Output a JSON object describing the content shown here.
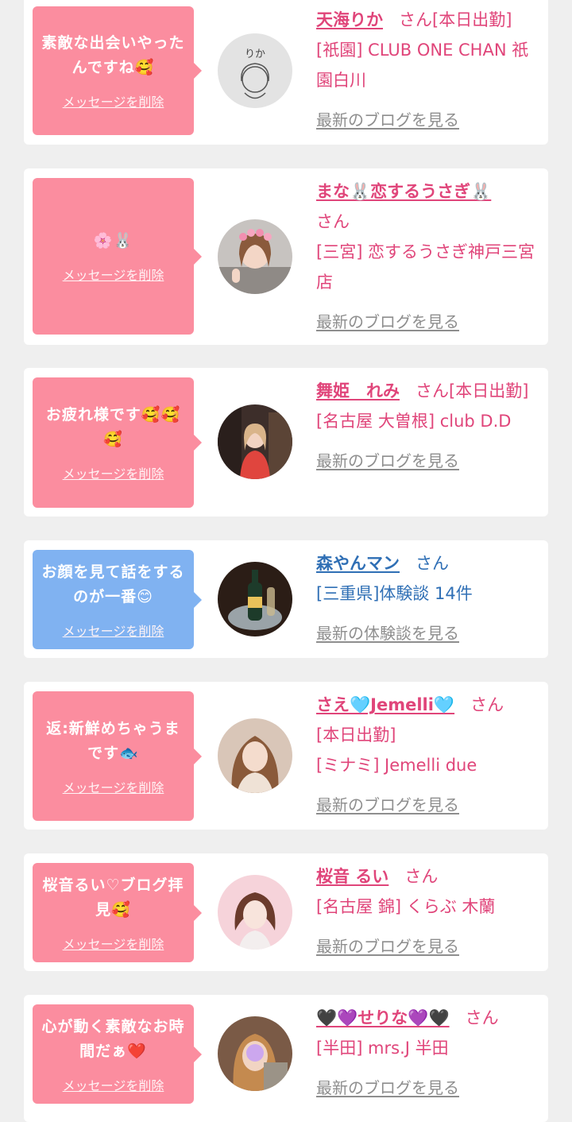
{
  "messages": [
    {
      "text": "素敵な出会いやったんですね🥰",
      "delete_label": "メッセージを削除",
      "name": "天海りか",
      "suffix": "さん[本日出勤]",
      "detail": "[祇園] CLUB ONE CHAN 祇園白川",
      "blog_label": "最新のブログを見る",
      "avatar_text": "りか",
      "colors": {
        "bubble": "#fb8d9f",
        "text": "#e0457a"
      }
    },
    {
      "text": "🌸🐰",
      "delete_label": "メッセージを削除",
      "name": "まな🐰恋するうさぎ🐰",
      "suffix": "さん",
      "detail": "[三宮] 恋するうさぎ神戸三宮店",
      "blog_label": "最新のブログを見る",
      "colors": {
        "bubble": "#fb8d9f",
        "text": "#e0457a"
      }
    },
    {
      "text": "お疲れ様です🥰🥰🥰",
      "delete_label": "メッセージを削除",
      "name": "舞姫　れみ",
      "suffix": "さん[本日出勤]",
      "detail": "[名古屋 大曽根] club D.D",
      "blog_label": "最新のブログを見る",
      "colors": {
        "bubble": "#fb8d9f",
        "text": "#e0457a"
      }
    },
    {
      "text": "お顔を見て話をするのが一番😊",
      "delete_label": "メッセージを削除",
      "name": "森やんマン",
      "suffix": "さん",
      "detail": "[三重県]体験談 14件",
      "blog_label": "最新の体験談を見る",
      "colors": {
        "bubble": "#80b2f1",
        "text": "#2f6fb5"
      }
    },
    {
      "text": "返:新鮮めちゃうまです🐟",
      "delete_label": "メッセージを削除",
      "name": "さえ🩵Jemelli🩵",
      "suffix": "さん",
      "status": "[本日出勤]",
      "detail": "[ミナミ] Jemelli due",
      "blog_label": "最新のブログを見る",
      "colors": {
        "bubble": "#fb8d9f",
        "text": "#e0457a"
      }
    },
    {
      "text": "桜音るい♡ブログ拝見🥰",
      "delete_label": "メッセージを削除",
      "name": "桜音 るい",
      "suffix": "さん",
      "detail": "[名古屋 錦] くらぶ 木蘭",
      "blog_label": "最新のブログを見る",
      "colors": {
        "bubble": "#fb8d9f",
        "text": "#e0457a"
      }
    },
    {
      "text": "心が動く素敵なお時間だぁ❤️",
      "delete_label": "メッセージを削除",
      "name": "🖤💜せりな💜🖤",
      "suffix": "さん",
      "detail": "[半田] mrs.J 半田",
      "blog_label": "最新のブログを見る",
      "colors": {
        "bubble": "#fb8d9f",
        "text": "#e0457a"
      }
    }
  ]
}
